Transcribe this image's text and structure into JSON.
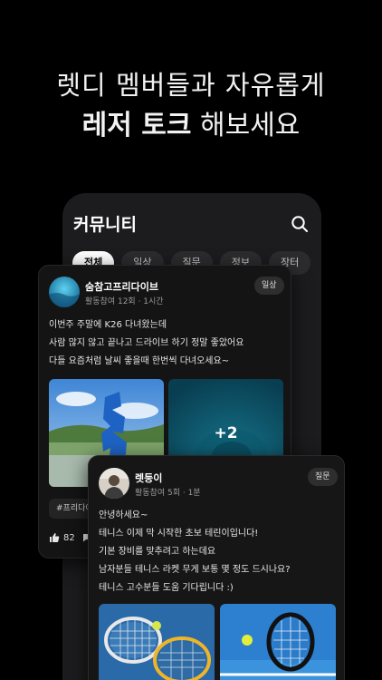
{
  "headline": {
    "line1": "렛디 멤버들과 자유롭게",
    "line2_bold": "레저 토크",
    "line2_rest": " 해보세요"
  },
  "screen": {
    "title": "커뮤니티",
    "tabs": [
      {
        "label": "전체",
        "active": true
      },
      {
        "label": "일상"
      },
      {
        "label": "질문"
      },
      {
        "label": "정보"
      },
      {
        "label": "장터"
      }
    ]
  },
  "post1": {
    "username": "숨참고프리다이브",
    "meta": "활동참여 12회 · 1시간",
    "badge": "일상",
    "lines": [
      "이번주 주말에 K26 다녀왔는데",
      "사람 많지 않고 끝나고 드라이브 하기 정말 좋았어요",
      "다들 요즘처럼 날씨 좋을때 한번씩 다녀오세요~"
    ],
    "more_photos": "+2",
    "tag": "#프리다이",
    "likes": "82"
  },
  "post2": {
    "username": "렛둥이",
    "meta": "활동참여 5회 · 1분",
    "badge": "질문",
    "lines": [
      "안녕하세요~",
      "테니스 이제 막 시작한 초보 테린이입니다!",
      "기본 장비를 맞추려고 하는데요",
      "남자분들 테니스 라켓 무게 보통 몇 정도 드시나요?",
      "테니스 고수분들 도움 기다립니다 :)"
    ]
  }
}
